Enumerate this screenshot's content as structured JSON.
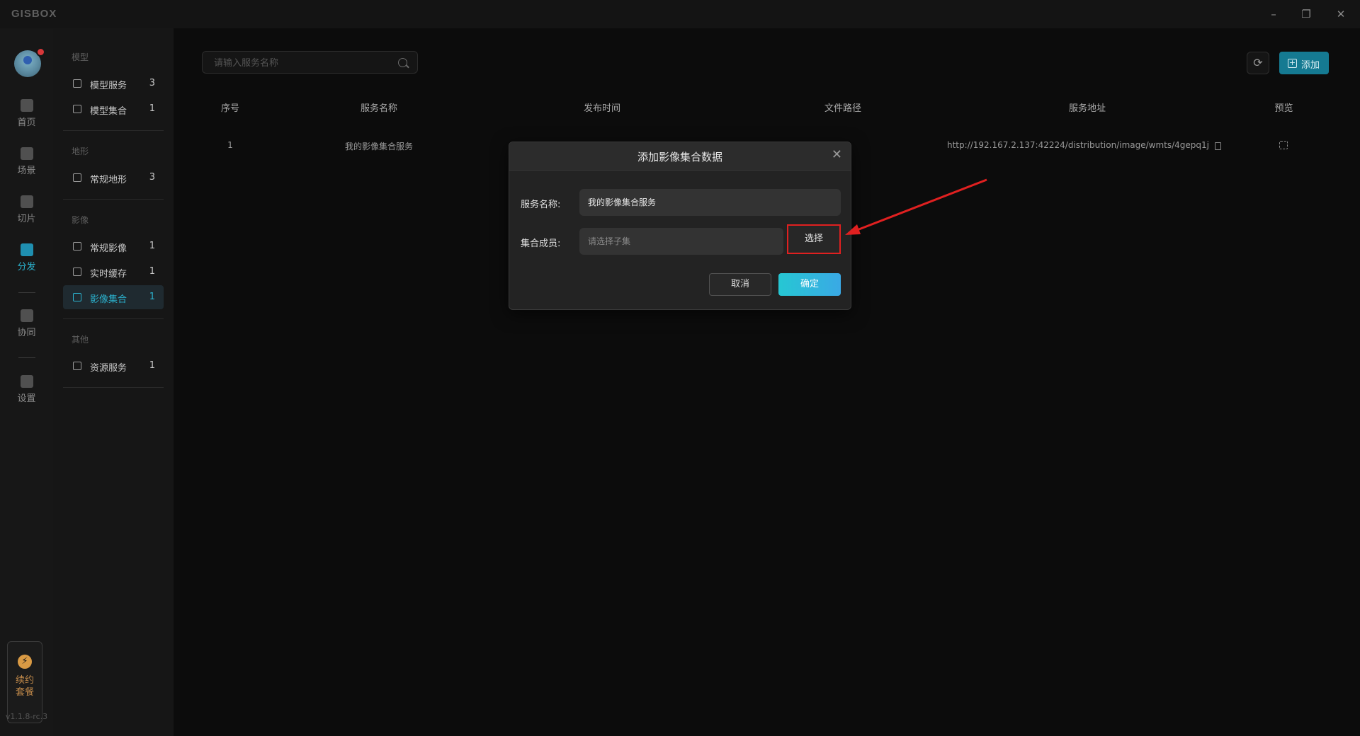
{
  "app": {
    "title": "GISBOX",
    "version": "v1.1.8-rc.3"
  },
  "window": {
    "minimize_icon": "minimize-icon",
    "restore_icon": "restore-icon",
    "close_icon": "close-icon"
  },
  "rail": {
    "items": [
      {
        "label": "首页",
        "icon": "home-icon"
      },
      {
        "label": "场景",
        "icon": "scene-icon"
      },
      {
        "label": "切片",
        "icon": "tile-icon"
      },
      {
        "label": "分发",
        "icon": "distribute-icon",
        "active": true
      },
      {
        "label": "协同",
        "icon": "collab-icon"
      },
      {
        "label": "设置",
        "icon": "settings-icon"
      }
    ],
    "plan_label": "续约套餐"
  },
  "catnav": {
    "groups": [
      {
        "title": "模型",
        "items": [
          {
            "label": "模型服务",
            "count": "3"
          },
          {
            "label": "模型集合",
            "count": "1"
          }
        ]
      },
      {
        "title": "地形",
        "items": [
          {
            "label": "常规地形",
            "count": "3"
          }
        ]
      },
      {
        "title": "影像",
        "items": [
          {
            "label": "常规影像",
            "count": "1"
          },
          {
            "label": "实时缓存",
            "count": "1"
          },
          {
            "label": "影像集合",
            "count": "1",
            "active": true
          }
        ]
      },
      {
        "title": "其他",
        "items": [
          {
            "label": "资源服务",
            "count": "1"
          }
        ]
      }
    ]
  },
  "toolbar": {
    "search_placeholder": "请输入服务名称",
    "add_label": "添加"
  },
  "table": {
    "headers": [
      "序号",
      "服务名称",
      "发布时间",
      "文件路径",
      "服务地址",
      "预览"
    ],
    "rows": [
      {
        "index": "1",
        "name": "我的影像集合服务",
        "url": "http://192.167.2.137:42224/distribution/image/wmts/4gepq1jd..."
      }
    ]
  },
  "modal": {
    "title": "添加影像集合数据",
    "service_name_label": "服务名称:",
    "service_name_value": "我的影像集合服务",
    "members_label": "集合成员:",
    "members_placeholder": "请选择子集",
    "select_label": "选择",
    "cancel_label": "取消",
    "ok_label": "确定"
  },
  "colors": {
    "accent": "#2bb3cf",
    "highlight": "#e02020"
  }
}
